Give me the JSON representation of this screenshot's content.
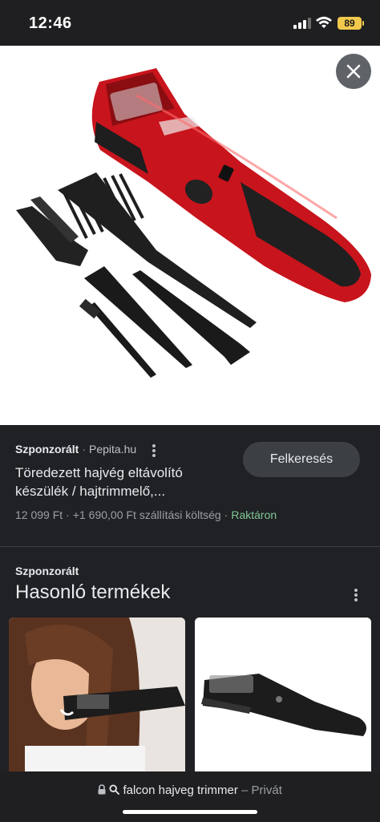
{
  "status_bar": {
    "time": "12:46",
    "battery": "89"
  },
  "listing": {
    "sponsored_label": "Szponzorált",
    "source": "Pepita.hu",
    "title": "Töredezett hajvég eltávolító készülék / hajtrimmelő,...",
    "price": "12 099 Ft",
    "shipping": "+1 690,00 Ft szállítási költség",
    "stock": "Raktáron",
    "search_button_label": "Felkeresés"
  },
  "similar": {
    "sponsored_label": "Szponzorált",
    "title": "Hasonló termékek"
  },
  "url_bar": {
    "query": "falcon hajveg trimmer",
    "mode": "– Privát"
  },
  "colors": {
    "accent_red": "#c8141c",
    "stock_green": "#81c995",
    "background": "#202124"
  },
  "icons": [
    "signal-icon",
    "wifi-icon",
    "battery-icon",
    "close-icon",
    "more-vert-icon",
    "lock-icon",
    "search-icon"
  ]
}
